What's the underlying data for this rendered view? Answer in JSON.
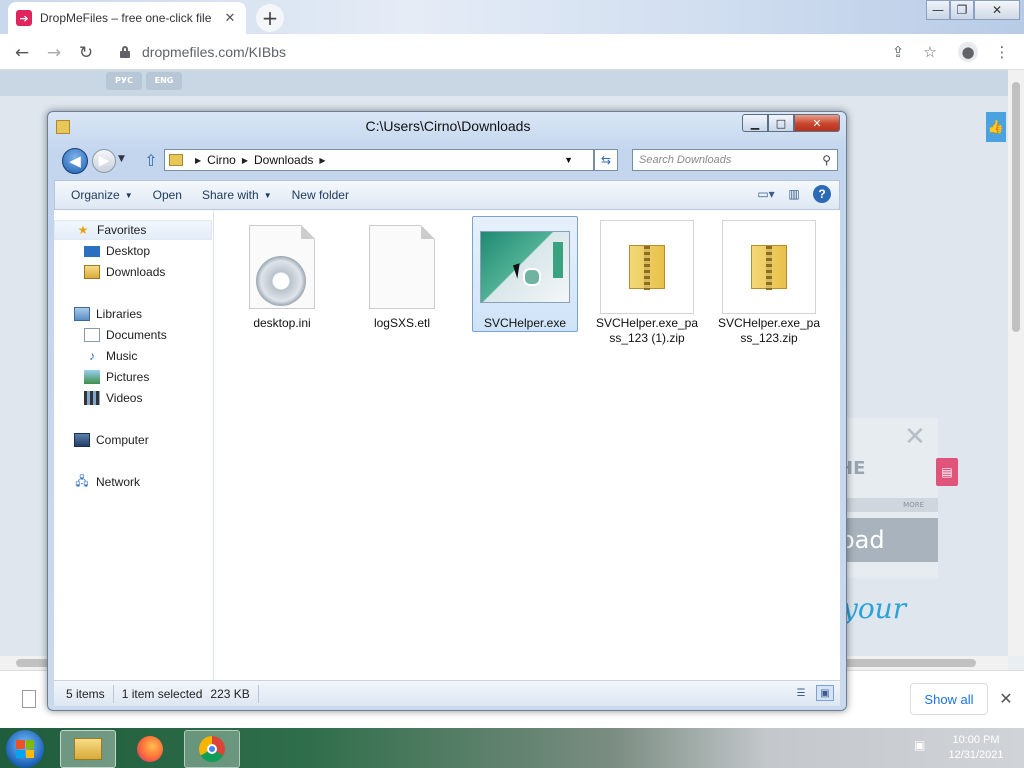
{
  "browser": {
    "tab_title": "DropMeFiles – free one-click file",
    "tab_favicon": "dropmefiles-icon",
    "url": "dropmefiles.com/KIBbs",
    "new_tab": "+",
    "close_glyph": "✕"
  },
  "page": {
    "langs": [
      "РУС",
      "ENG"
    ],
    "promo_text": "НЕ",
    "promo_more": "MORE",
    "promo_load": "oad",
    "script_text": "your"
  },
  "download_bar": {
    "show_all": "Show all",
    "close": "✕"
  },
  "taskbar": {
    "time": "10:00 PM",
    "date": "12/31/2021"
  },
  "explorer": {
    "title": "C:\\Users\\Cirno\\Downloads",
    "address": [
      "Cirno",
      "Downloads"
    ],
    "search_placeholder": "Search Downloads",
    "commands": {
      "organize": "Organize",
      "open": "Open",
      "share_with": "Share with",
      "new_folder": "New folder"
    },
    "nav": {
      "favorites": "Favorites",
      "desktop": "Desktop",
      "downloads": "Downloads",
      "libraries": "Libraries",
      "documents": "Documents",
      "music": "Music",
      "pictures": "Pictures",
      "videos": "Videos",
      "computer": "Computer",
      "network": "Network"
    },
    "files": [
      {
        "name": "desktop.ini",
        "icon": "settings-file-icon"
      },
      {
        "name": "logSXS.etl",
        "icon": "blank-file-icon"
      },
      {
        "name": "SVCHelper.exe",
        "icon": "exe-icon",
        "selected": true
      },
      {
        "name": "SVCHelper.exe_pass_123 (1).zip",
        "icon": "zip-folder-icon"
      },
      {
        "name": "SVCHelper.exe_pass_123.zip",
        "icon": "zip-folder-icon"
      }
    ],
    "status": {
      "items": "5 items",
      "selected": "1 item selected",
      "size": "223 KB"
    }
  }
}
